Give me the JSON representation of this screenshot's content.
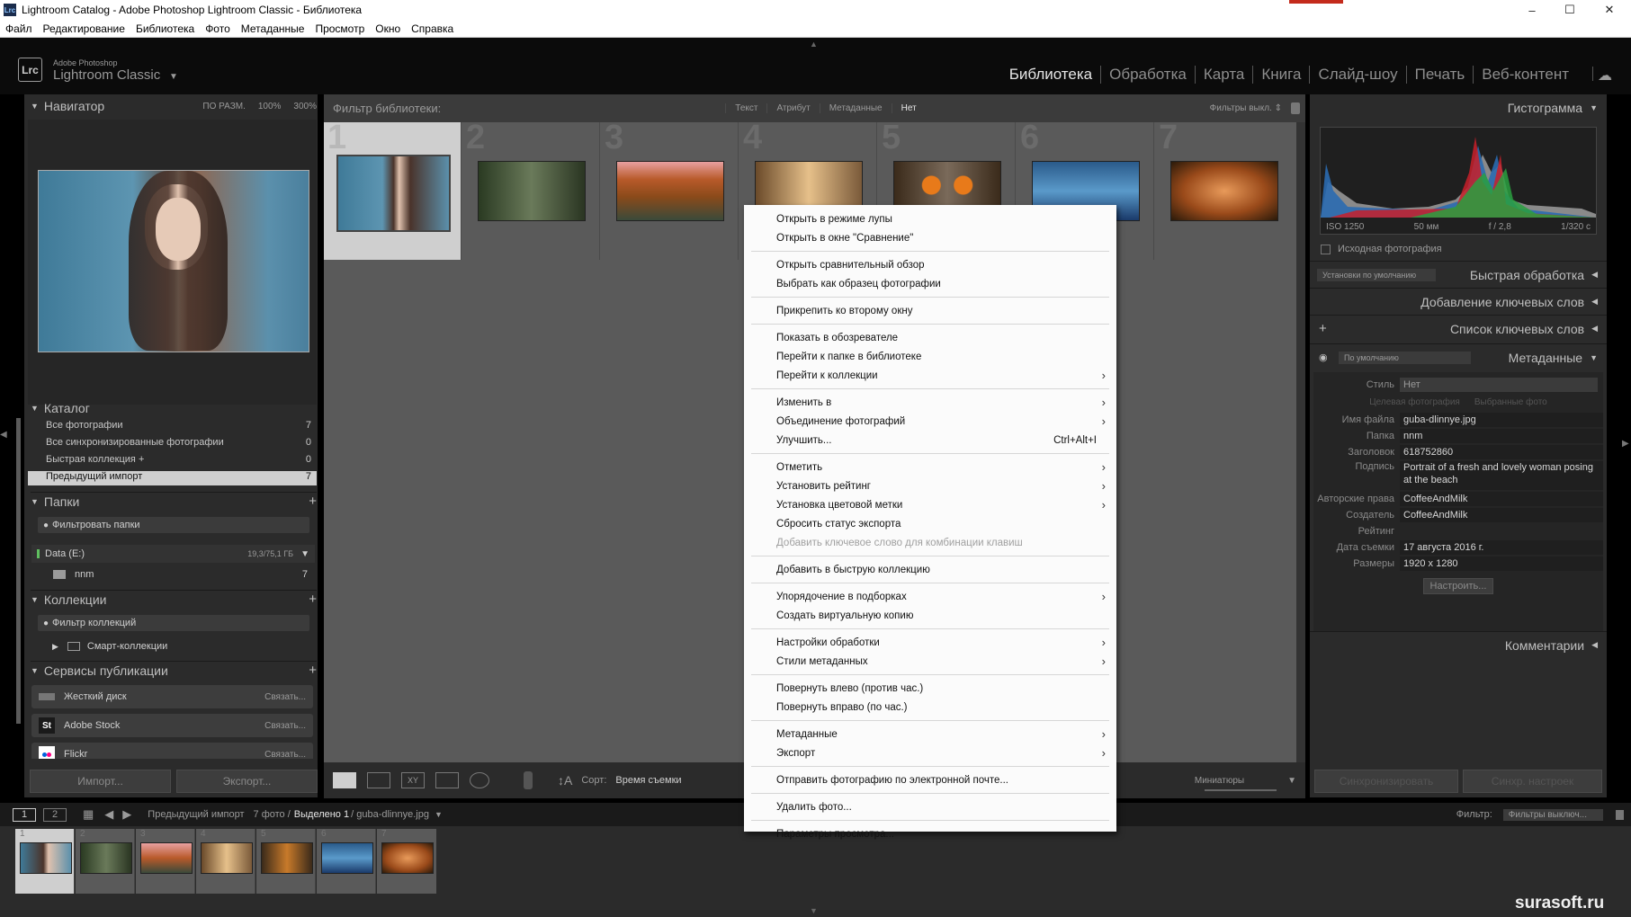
{
  "window": {
    "app_icon": "Lrc",
    "title": "Lightroom Catalog - Adobe Photoshop Lightroom Classic - Библиотека",
    "controls": [
      "–",
      "☐",
      "✕"
    ]
  },
  "menubar": [
    "Файл",
    "Редактирование",
    "Библиотека",
    "Фото",
    "Метаданные",
    "Просмотр",
    "Окно",
    "Справка"
  ],
  "identity": {
    "logo": "Lrc",
    "line1": "Adobe Photoshop",
    "line2": "Lightroom Classic"
  },
  "modules": [
    "Библиотека",
    "Обработка",
    "Карта",
    "Книга",
    "Слайд-шоу",
    "Печать",
    "Веб-контент"
  ],
  "active_module": "Библиотека",
  "navigator": {
    "title": "Навигатор",
    "zoom": [
      "ПО РАЗМ.",
      "100%",
      "300%"
    ]
  },
  "catalog": {
    "title": "Каталог",
    "items": [
      {
        "label": "Все фотографии",
        "count": "7"
      },
      {
        "label": "Все синхронизированные фотографии",
        "count": "0"
      },
      {
        "label": "Быстрая коллекция +",
        "count": "0"
      },
      {
        "label": "Предыдущий импорт",
        "count": "7"
      }
    ]
  },
  "folders": {
    "title": "Папки",
    "filter_placeholder": "Фильтровать папки",
    "volume": {
      "name": "Data (E:)",
      "size": "19,3/75,1 ГБ"
    },
    "folder": {
      "name": "nnm",
      "count": "7"
    }
  },
  "collections": {
    "title": "Коллекции",
    "filter_placeholder": "Фильтр коллекций",
    "items": [
      "Смарт-коллекции"
    ]
  },
  "publish": {
    "title": "Сервисы публикации",
    "items": [
      {
        "label": "Жесткий диск",
        "action": "Связать..."
      },
      {
        "label": "Adobe Stock",
        "action": "Связать..."
      },
      {
        "label": "Flickr",
        "action": "Связать..."
      }
    ]
  },
  "left_buttons": {
    "import": "Импорт...",
    "export": "Экспорт..."
  },
  "filter_bar": {
    "label": "Фильтр библиотеки:",
    "options": [
      "Текст",
      "Атрибут",
      "Метаданные",
      "Нет"
    ],
    "active": "Нет",
    "preset": "Фильтры выкл. ⇕"
  },
  "grid": {
    "cells": [
      {
        "num": "1",
        "selected": true
      },
      {
        "num": "2",
        "selected": false
      },
      {
        "num": "3",
        "selected": false
      },
      {
        "num": "4",
        "selected": false
      },
      {
        "num": "5",
        "selected": false
      },
      {
        "num": "6",
        "selected": false
      },
      {
        "num": "7",
        "selected": false
      }
    ]
  },
  "toolbar": {
    "sort_label": "Сорт:",
    "sort_value": "Время съемки",
    "thumbs_label": "Миниатюры"
  },
  "context_menu": {
    "groups": [
      [
        {
          "label": "Открыть в режиме лупы"
        },
        {
          "label": "Открыть в окне \"Сравнение\""
        }
      ],
      [
        {
          "label": "Открыть сравнительный обзор"
        },
        {
          "label": "Выбрать как образец фотографии"
        }
      ],
      [
        {
          "label": "Прикрепить ко второму окну"
        }
      ],
      [
        {
          "label": "Показать в обозревателе"
        },
        {
          "label": "Перейти к папке в библиотеке"
        },
        {
          "label": "Перейти к коллекции",
          "submenu": true
        }
      ],
      [
        {
          "label": "Изменить в",
          "submenu": true
        },
        {
          "label": "Объединение фотографий",
          "submenu": true
        },
        {
          "label": "Улучшить...",
          "shortcut": "Ctrl+Alt+I"
        }
      ],
      [
        {
          "label": "Отметить",
          "submenu": true
        },
        {
          "label": "Установить рейтинг",
          "submenu": true
        },
        {
          "label": "Установка цветовой метки",
          "submenu": true
        },
        {
          "label": "Сбросить статус экспорта"
        },
        {
          "label": "Добавить ключевое слово для комбинации клавиш",
          "disabled": true
        }
      ],
      [
        {
          "label": "Добавить в быструю коллекцию"
        }
      ],
      [
        {
          "label": "Упорядочение в подборках",
          "submenu": true
        },
        {
          "label": "Создать виртуальную копию"
        }
      ],
      [
        {
          "label": "Настройки обработки",
          "submenu": true
        },
        {
          "label": "Стили метаданных",
          "submenu": true
        }
      ],
      [
        {
          "label": "Повернуть влево (против час.)"
        },
        {
          "label": "Повернуть вправо (по час.)"
        }
      ],
      [
        {
          "label": "Метаданные",
          "submenu": true
        },
        {
          "label": "Экспорт",
          "submenu": true
        }
      ],
      [
        {
          "label": "Отправить фотографию по электронной почте..."
        }
      ],
      [
        {
          "label": "Удалить фото..."
        }
      ],
      [
        {
          "label": "Параметры просмотра..."
        }
      ]
    ]
  },
  "histogram": {
    "title": "Гистограмма",
    "info": [
      "ISO 1250",
      "50 мм",
      "f / 2,8",
      "1/320 с"
    ],
    "original_label": "Исходная фотография"
  },
  "right_panels": {
    "quick_develop": "Быстрая обработка",
    "quick_preset": "Установки по умолчанию",
    "keywording": "Добавление ключевых слов",
    "keyword_list": "Список ключевых слов",
    "metadata": "Метаданные",
    "metadata_preset": "По умолчанию",
    "comments": "Комментарии"
  },
  "metadata": {
    "style_label": "Стиль",
    "style_value": "Нет",
    "tabs": [
      "Целевая фотография",
      "Выбранные фото"
    ],
    "fields": [
      {
        "key": "Имя файла",
        "value": "guba-dlinnye.jpg"
      },
      {
        "key": "Папка",
        "value": "nnm"
      },
      {
        "key": "Заголовок",
        "value": "618752860"
      },
      {
        "key": "Подпись",
        "value": "Portrait of a fresh and lovely woman posing at the beach"
      },
      {
        "key": "Авторские права",
        "value": "CoffeeAndMilk"
      },
      {
        "key": "Создатель",
        "value": "CoffeeAndMilk"
      },
      {
        "key": "Рейтинг",
        "value": ""
      },
      {
        "key": "Дата съемки",
        "value": "17 августа 2016 г."
      },
      {
        "key": "Размеры",
        "value": "1920 x 1280"
      }
    ],
    "customize": "Настроить..."
  },
  "right_buttons": {
    "sync": "Синхронизировать",
    "sync_settings": "Синхр. настроек"
  },
  "filmstrip": {
    "pages": [
      "1",
      "2"
    ],
    "source": "Предыдущий импорт",
    "count": "7 фото /",
    "selected": "Выделено 1",
    "file": "/ guba-dlinnye.jpg",
    "filter_label": "Фильтр:",
    "filter_value": "Фильтры выключ..."
  },
  "watermark": "surasoft.ru",
  "colors": {
    "accent_selected": "#cfcfcf",
    "panel": "#2b2b2b",
    "grid_bg": "#5a5a5a",
    "menu_bg": "#fbfbfb"
  }
}
